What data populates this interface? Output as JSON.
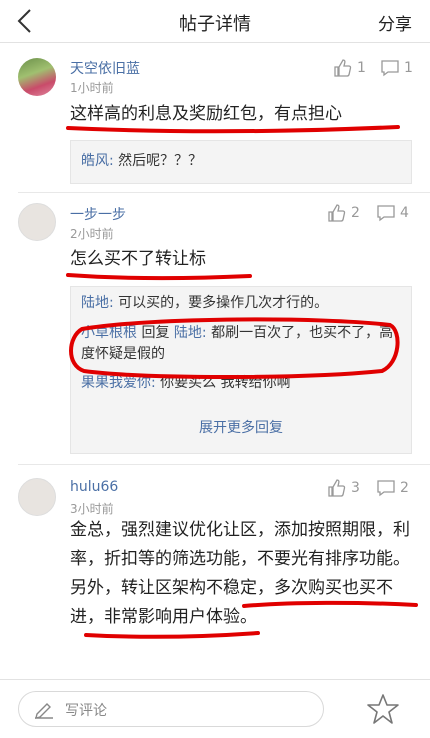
{
  "nav": {
    "title": "帖子详情",
    "share": "分享"
  },
  "comments": [
    {
      "user": "天空依旧蓝",
      "time": "1小时前",
      "likes": "1",
      "replies_count": "1",
      "text": "这样高的利息及奖励红包，有点担心",
      "replies": [
        {
          "name": "皓风:",
          "text": "然后呢？？？"
        }
      ]
    },
    {
      "user": "一步一步",
      "time": "2小时前",
      "likes": "2",
      "replies_count": "4",
      "text": "怎么买不了转让标",
      "replies": [
        {
          "name": "陆地:",
          "text": "可以买的，要多操作几次才行的。"
        },
        {
          "name": "小草根根",
          "mid": "回复",
          "name2": "陆地:",
          "text": "都刷一百次了，也买不了，高度怀疑是假的"
        },
        {
          "name": "果果我爱你:",
          "text": "你要买么 我转给你啊"
        }
      ],
      "more": "展开更多回复"
    },
    {
      "user": "hulu66",
      "time": "3小时前",
      "likes": "3",
      "replies_count": "2",
      "text": "金总，强烈建议优化让区，添加按照期限，利率，折扣等的筛选功能，不要光有排序功能。另外，转让区架构不稳定，多次购买也买不进，非常影响用户体验。"
    }
  ],
  "bottom": {
    "placeholder": "写评论"
  },
  "colors": {
    "link": "#4a6fa5",
    "annotation": "#e00000"
  }
}
